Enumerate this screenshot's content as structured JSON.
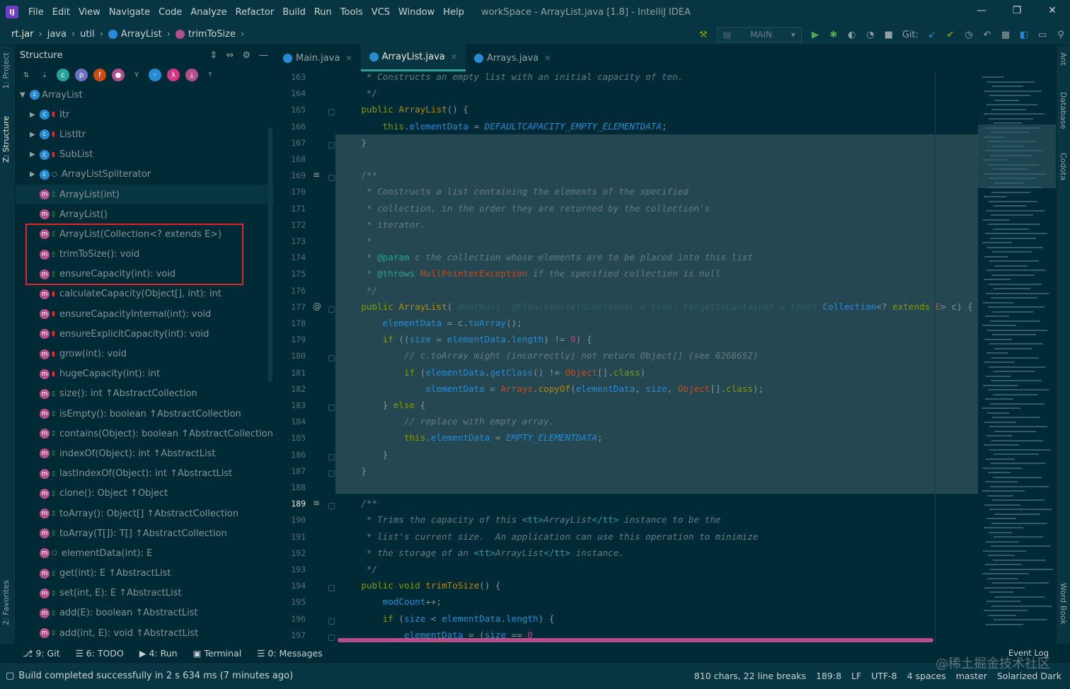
{
  "menu": {
    "items": [
      "File",
      "Edit",
      "View",
      "Navigate",
      "Code",
      "Analyze",
      "Refactor",
      "Build",
      "Run",
      "Tools",
      "VCS",
      "Window",
      "Help"
    ],
    "title": "workSpace - ArrayList.java [1.8] - IntelliJ IDEA"
  },
  "breadcrumb": {
    "items": [
      "rt.jar",
      "java",
      "util",
      "ArrayList",
      "trimToSize"
    ]
  },
  "toolbar": {
    "run_config": "MAIN",
    "git_label": "Git:"
  },
  "left_strip": {
    "project": "1: Project",
    "structure": "Z: Structure",
    "favorites": "2: Favorites"
  },
  "right_strip": {
    "ant": "Ant",
    "database": "Database",
    "codota": "Codota",
    "wordbook": "Word Book"
  },
  "structure": {
    "title": "Structure",
    "root": "ArrayList",
    "items": [
      {
        "label": "Itr",
        "kind": "class",
        "vis": "pri",
        "expand": true
      },
      {
        "label": "ListItr",
        "kind": "class",
        "vis": "pri",
        "expand": true
      },
      {
        "label": "SubList",
        "kind": "class",
        "vis": "pri",
        "expand": true
      },
      {
        "label": "ArrayListSpliterator",
        "kind": "class",
        "vis": "pkg",
        "expand": true
      },
      {
        "label": "ArrayList(int)",
        "kind": "method",
        "vis": "pub"
      },
      {
        "label": "ArrayList()",
        "kind": "method",
        "vis": "pub"
      },
      {
        "label": "ArrayList(Collection<? extends E>)",
        "kind": "method",
        "vis": "pub"
      },
      {
        "label": "trimToSize(): void",
        "kind": "method",
        "vis": "pub"
      },
      {
        "label": "ensureCapacity(int): void",
        "kind": "method",
        "vis": "pub"
      },
      {
        "label": "calculateCapacity(Object[], int): int",
        "kind": "method",
        "vis": "pri"
      },
      {
        "label": "ensureCapacityInternal(int): void",
        "kind": "method",
        "vis": "pri"
      },
      {
        "label": "ensureExplicitCapacity(int): void",
        "kind": "method",
        "vis": "pri"
      },
      {
        "label": "grow(int): void",
        "kind": "method",
        "vis": "pri"
      },
      {
        "label": "hugeCapacity(int): int",
        "kind": "method",
        "vis": "pri"
      },
      {
        "label": "size(): int ↑AbstractCollection",
        "kind": "method",
        "vis": "pub"
      },
      {
        "label": "isEmpty(): boolean ↑AbstractCollection",
        "kind": "method",
        "vis": "pub"
      },
      {
        "label": "contains(Object): boolean ↑AbstractCollection",
        "kind": "method",
        "vis": "pub"
      },
      {
        "label": "indexOf(Object): int ↑AbstractList",
        "kind": "method",
        "vis": "pub"
      },
      {
        "label": "lastIndexOf(Object): int ↑AbstractList",
        "kind": "method",
        "vis": "pub"
      },
      {
        "label": "clone(): Object ↑Object",
        "kind": "method",
        "vis": "pub"
      },
      {
        "label": "toArray(): Object[] ↑AbstractCollection",
        "kind": "method",
        "vis": "pub"
      },
      {
        "label": "toArray(T[]): T[] ↑AbstractCollection",
        "kind": "method",
        "vis": "pub"
      },
      {
        "label": "elementData(int): E",
        "kind": "method",
        "vis": "pkg"
      },
      {
        "label": "get(int): E ↑AbstractList",
        "kind": "method",
        "vis": "pub"
      },
      {
        "label": "set(int, E): E ↑AbstractList",
        "kind": "method",
        "vis": "pub"
      },
      {
        "label": "add(E): boolean ↑AbstractList",
        "kind": "method",
        "vis": "pub"
      },
      {
        "label": "add(int, E): void ↑AbstractList",
        "kind": "method",
        "vis": "pub"
      }
    ]
  },
  "tabs": [
    {
      "label": "Main.java",
      "active": false
    },
    {
      "label": "ArrayList.java",
      "active": true
    },
    {
      "label": "Arrays.java",
      "active": false
    }
  ],
  "gutter": {
    "lines": [
      "163",
      "164",
      "165",
      "166",
      "167",
      "168",
      "169",
      "170",
      "171",
      "172",
      "173",
      "174",
      "175",
      "176",
      "177",
      "178",
      "179",
      "180",
      "181",
      "182",
      "183",
      "184",
      "185",
      "186",
      "187",
      "188",
      "189",
      "190",
      "191",
      "192",
      "193",
      "194",
      "195",
      "196",
      "197"
    ],
    "current": "189"
  },
  "code": [
    [
      [
        "cm",
        "     * Constructs an empty list with an initial capacity of ten."
      ]
    ],
    [
      [
        "cm",
        "     */"
      ]
    ],
    [
      [
        "kw",
        "    public "
      ],
      [
        "fn",
        "ArrayList"
      ],
      [
        "",
        "() {"
      ]
    ],
    [
      [
        "kw",
        "        this"
      ],
      [
        "",
        "."
      ],
      [
        "fd",
        "elementData"
      ],
      [
        "",
        " = "
      ],
      [
        "st",
        "DEFAULTCAPACITY_EMPTY_ELEMENTDATA"
      ],
      [
        "",
        ";"
      ]
    ],
    [
      [
        "",
        "    }"
      ]
    ],
    [
      [
        "",
        ""
      ]
    ],
    [
      [
        "cm",
        "    /**"
      ]
    ],
    [
      [
        "cm",
        "     * Constructs a list containing the elements of the specified"
      ]
    ],
    [
      [
        "cm",
        "     * collection, in the order they are returned by the collection's"
      ]
    ],
    [
      [
        "cm",
        "     * iterator."
      ]
    ],
    [
      [
        "cm",
        "     *"
      ]
    ],
    [
      [
        "cm",
        "     * "
      ],
      [
        "tg",
        "@param"
      ],
      [
        "cm",
        " c the collection whose elements are to be placed into this list"
      ]
    ],
    [
      [
        "cm",
        "     * "
      ],
      [
        "tg",
        "@throws"
      ],
      [
        "ty",
        " NullPointerException"
      ],
      [
        "cm",
        " if the specified collection is null"
      ]
    ],
    [
      [
        "cm",
        "     */"
      ]
    ],
    [
      [
        "kw",
        "    public "
      ],
      [
        "fn",
        "ArrayList"
      ],
      [
        "",
        "( "
      ],
      [
        "an",
        "@NotNull  @Flow(sourceIsContainer = true, targetIsContainer = true)"
      ],
      [
        "fd",
        " Collection"
      ],
      [
        "",
        "<? "
      ],
      [
        "kw",
        "extends "
      ],
      [
        "ty",
        "E"
      ],
      [
        "",
        "> c) {"
      ]
    ],
    [
      [
        "fd",
        "        elementData"
      ],
      [
        "",
        " = c."
      ],
      [
        "fd",
        "toArray"
      ],
      [
        "",
        "();"
      ]
    ],
    [
      [
        "kw",
        "        if "
      ],
      [
        "",
        "(("
      ],
      [
        "fd",
        "size"
      ],
      [
        "",
        " = "
      ],
      [
        "fd",
        "elementData"
      ],
      [
        "",
        "."
      ],
      [
        "fd",
        "length"
      ],
      [
        "",
        ") != "
      ],
      [
        "cn",
        "0"
      ],
      [
        "",
        ") {"
      ]
    ],
    [
      [
        "cm",
        "            // c.toArray might (incorrectly) not return Object[] (see 6268652)"
      ]
    ],
    [
      [
        "kw",
        "            if "
      ],
      [
        "",
        "("
      ],
      [
        "fd",
        "elementData"
      ],
      [
        "",
        "."
      ],
      [
        "fd",
        "getClass"
      ],
      [
        "",
        "() != "
      ],
      [
        "ty",
        "Object"
      ],
      [
        "",
        "[]."
      ],
      [
        "kw",
        "class"
      ],
      [
        "",
        ")"
      ]
    ],
    [
      [
        "fd",
        "                elementData"
      ],
      [
        "",
        " = "
      ],
      [
        "ty",
        "Arrays"
      ],
      [
        "",
        "."
      ],
      [
        "fn",
        "copyOf"
      ],
      [
        "",
        "("
      ],
      [
        "fd",
        "elementData"
      ],
      [
        "",
        ", "
      ],
      [
        "fd",
        "size"
      ],
      [
        "",
        ", "
      ],
      [
        "ty",
        "Object"
      ],
      [
        "",
        "[]."
      ],
      [
        "kw",
        "class"
      ],
      [
        "",
        ");"
      ]
    ],
    [
      [
        "",
        "        } "
      ],
      [
        "kw",
        "else "
      ],
      [
        "",
        "{"
      ]
    ],
    [
      [
        "cm",
        "            // replace with empty array."
      ]
    ],
    [
      [
        "kw",
        "            this"
      ],
      [
        "",
        "."
      ],
      [
        "fd",
        "elementData"
      ],
      [
        "",
        " = "
      ],
      [
        "st",
        "EMPTY_ELEMENTDATA"
      ],
      [
        "",
        ";"
      ]
    ],
    [
      [
        "",
        "        }"
      ]
    ],
    [
      [
        "",
        "    }"
      ]
    ],
    [
      [
        "",
        ""
      ]
    ],
    [
      [
        "cm",
        "    /**"
      ]
    ],
    [
      [
        "cm",
        "     * Trims the capacity of this "
      ],
      [
        "tg",
        "<tt>"
      ],
      [
        "cm",
        "ArrayList"
      ],
      [
        "tg",
        "</tt>"
      ],
      [
        "cm",
        " instance to be the"
      ]
    ],
    [
      [
        "cm",
        "     * list's current size.  An application can use this operation to minimize"
      ]
    ],
    [
      [
        "cm",
        "     * the storage of an "
      ],
      [
        "tg",
        "<tt>"
      ],
      [
        "cm",
        "ArrayList"
      ],
      [
        "tg",
        "</tt>"
      ],
      [
        "cm",
        " instance."
      ]
    ],
    [
      [
        "cm",
        "     */"
      ]
    ],
    [
      [
        "kw",
        "    public void "
      ],
      [
        "fn",
        "trimToSize"
      ],
      [
        "",
        "() {"
      ]
    ],
    [
      [
        "fd",
        "        modCount"
      ],
      [
        "",
        "++;"
      ]
    ],
    [
      [
        "kw",
        "        if "
      ],
      [
        "",
        "("
      ],
      [
        "fd",
        "size"
      ],
      [
        "",
        " < "
      ],
      [
        "fd",
        "elementData"
      ],
      [
        "",
        "."
      ],
      [
        "fd",
        "length"
      ],
      [
        "",
        ") {"
      ]
    ],
    [
      [
        "fd",
        "            elementData"
      ],
      [
        "",
        " = ("
      ],
      [
        "fd",
        "size"
      ],
      [
        "",
        " == "
      ],
      [
        "cn",
        "0"
      ],
      [
        ")",
        ""
      ]
    ]
  ],
  "bottom_tabs": [
    "9: Git",
    "6: TODO",
    "4: Run",
    "Terminal",
    "0: Messages"
  ],
  "status": {
    "message": "Build completed successfully in 2 s 634 ms (7 minutes ago)",
    "chars": "810 chars, 22 line breaks",
    "pos": "189:8",
    "lf": "LF",
    "enc": "UTF-8",
    "indent": "4 spaces",
    "branch": "master",
    "theme": "Solarized Dark",
    "event_log": "Event Log",
    "watermark": "@稀土掘金技术社区"
  }
}
